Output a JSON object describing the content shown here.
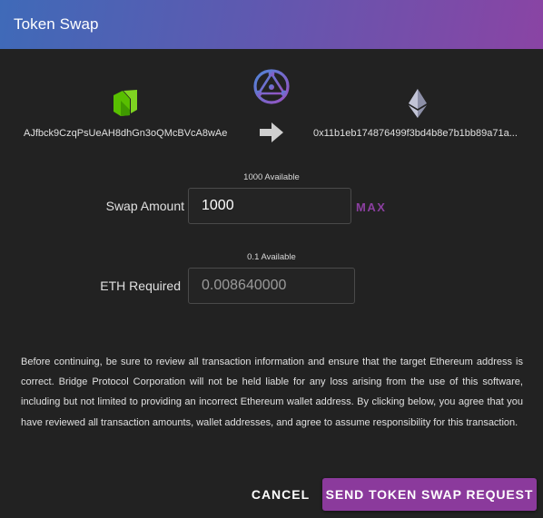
{
  "dialog": {
    "title": "Token Swap"
  },
  "swap": {
    "from_address": "AJfbck9CzqPsUeAH8dhGn3oQMcBVcA8wAe",
    "to_address": "0x11b1eb174876499f3bd4b8e7b1bb89a71a..."
  },
  "form": {
    "swap_available": "1000 Available",
    "swap_label": "Swap Amount",
    "swap_value": "1000",
    "max_label": "MAX",
    "eth_available": "0.1 Available",
    "eth_label": "ETH Required",
    "eth_value": "0.008640000"
  },
  "disclaimer": "Before continuing, be sure to review all transaction information and ensure that the target Ethereum address is correct. Bridge Protocol Corporation will not be held liable for any loss arising from the use of this software, including but not limited to providing an incorrect Ethereum wallet address. By clicking below, you agree that you have reviewed all transaction amounts, wallet addresses, and agree to assume responsibility for this transaction.",
  "actions": {
    "cancel_label": "CANCEL",
    "send_label": "SEND TOKEN SWAP REQUEST"
  },
  "icons": {
    "neo": "neo-logo-icon",
    "bridge": "bridge-protocol-logo-icon",
    "arrow": "arrow-right-icon",
    "eth": "ethereum-logo-icon"
  },
  "colors": {
    "accent": "#8b3a9c",
    "neo_green": "#58bf00",
    "background": "#222222"
  }
}
